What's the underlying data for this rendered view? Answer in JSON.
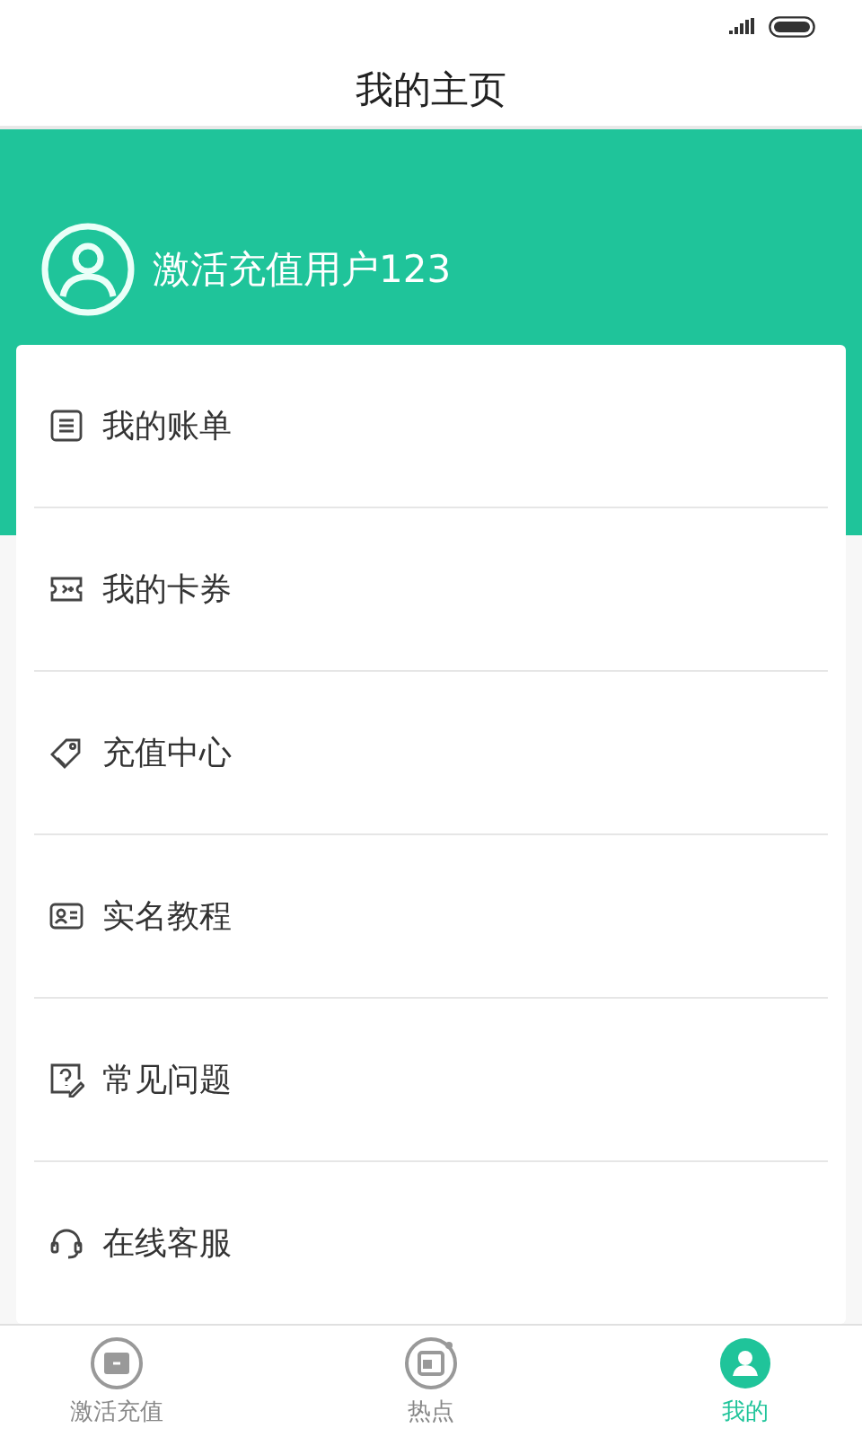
{
  "title": "我的主页",
  "user": {
    "name": "激活充值用户123"
  },
  "menu": [
    {
      "kind": "bill",
      "label": "我的账单"
    },
    {
      "kind": "coupon",
      "label": "我的卡券"
    },
    {
      "kind": "tag",
      "label": "充值中心"
    },
    {
      "kind": "idcard",
      "label": "实名教程"
    },
    {
      "kind": "question",
      "label": "常见问题"
    },
    {
      "kind": "headset",
      "label": "在线客服"
    }
  ],
  "tabs": [
    {
      "kind": "card",
      "label": "激活充值",
      "selected": false
    },
    {
      "kind": "news",
      "label": "热点",
      "selected": false
    },
    {
      "kind": "user",
      "label": "我的",
      "selected": true
    }
  ]
}
